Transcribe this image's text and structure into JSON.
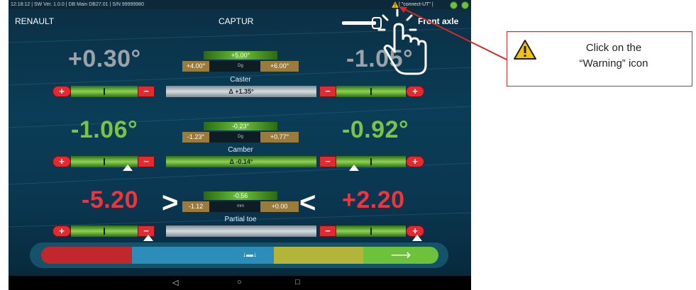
{
  "status_bar": {
    "info": "12:18:12  |  SW Ver. 1.0.0  |  DB Main DB27.01  |  S/N 99999980",
    "connection": "| \"connect-UT\" |"
  },
  "header": {
    "brand": "RENAULT",
    "model": "CAPTUR",
    "axle": "Front axle"
  },
  "params": [
    {
      "name": "Caster",
      "left_value": "+0.30°",
      "right_value": "-1.05°",
      "target": "+5.00°",
      "min": "+4.00°",
      "unit": "Dg",
      "max": "+6.00°",
      "delta": "Δ +1.35°"
    },
    {
      "name": "Camber",
      "left_value": "-1.06°",
      "right_value": "-0.92°",
      "target": "-0.23°",
      "min": "-1.23°",
      "unit": "Dg",
      "max": "+0.77°",
      "delta": "Δ -0.14°"
    },
    {
      "name": "Partial toe",
      "left_value": "-5.20",
      "right_value": "+2.20",
      "target": "-0.56",
      "min": "-1.12",
      "unit": "mm",
      "max": "+0.00",
      "delta": ""
    }
  ],
  "callout": {
    "line1": "Click on the",
    "line2": "“Warning” icon"
  },
  "colors": {
    "in_tolerance": "#7cc246",
    "out_of_tolerance": "#f0343c",
    "neutral": "#9aa3a8",
    "callout_border": "#d12a2a"
  },
  "icons": {
    "warning": "warning-triangle-icon",
    "pointer": "pointing-hand-icon",
    "connection": "status-dot-icon"
  }
}
